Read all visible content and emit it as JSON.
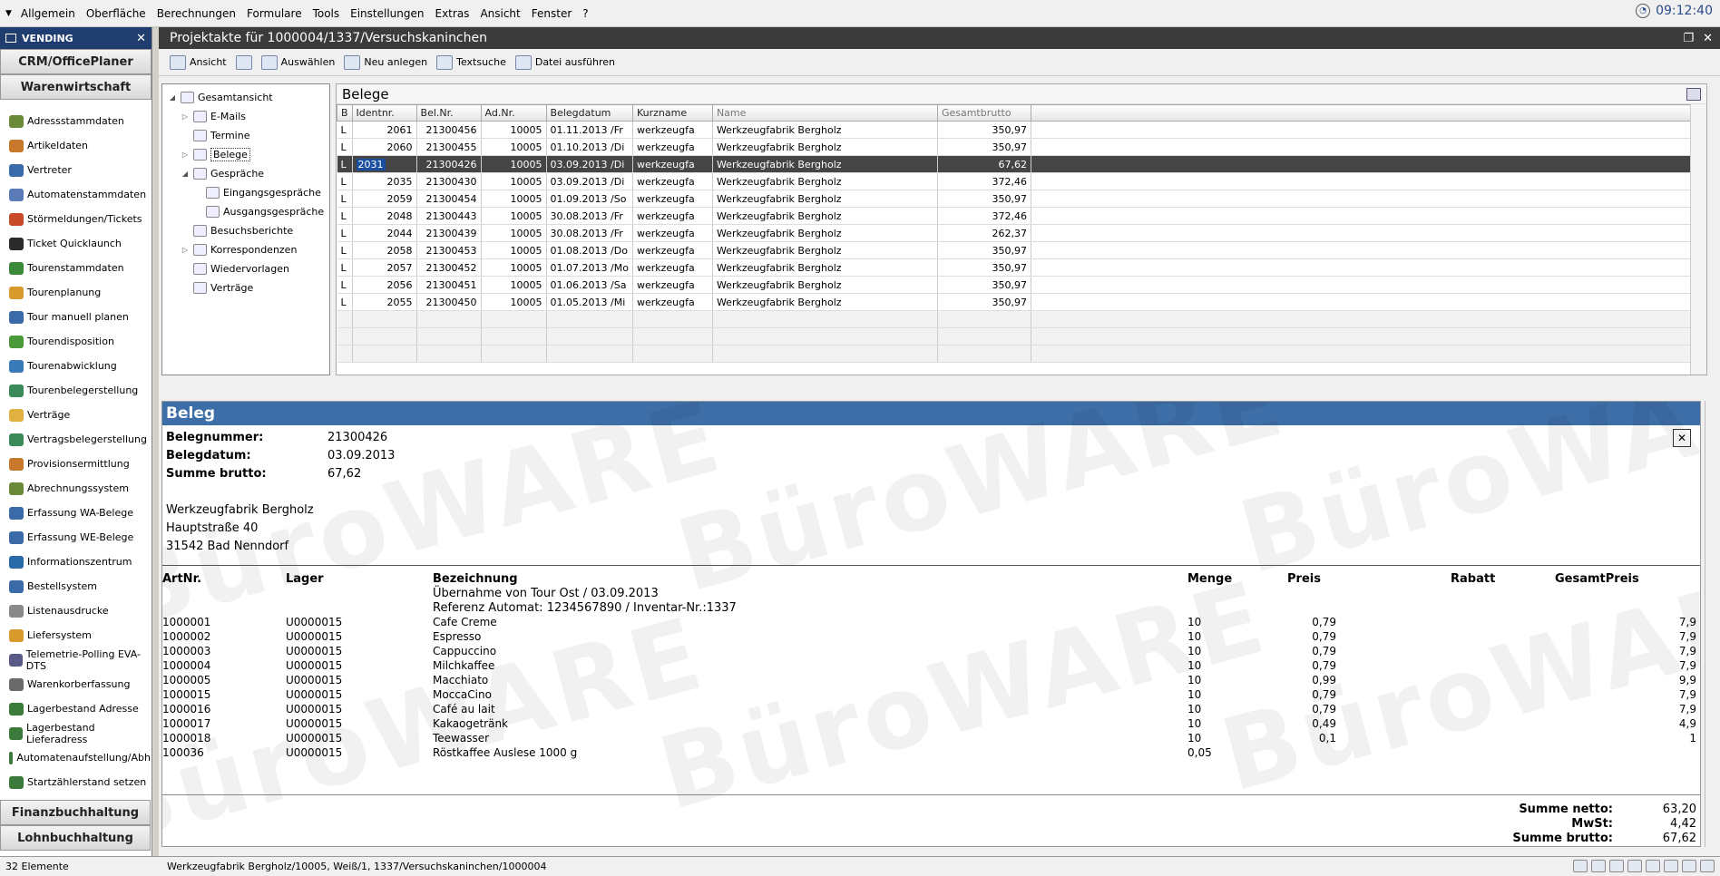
{
  "menu": [
    "Allgemein",
    "Oberfläche",
    "Berechnungen",
    "Formulare",
    "Tools",
    "Einstellungen",
    "Extras",
    "Ansicht",
    "Fenster",
    "?"
  ],
  "clock": "09:12:40",
  "leftnav": {
    "header": "VENDING",
    "top_modules": [
      "CRM/OfficePlaner",
      "Warenwirtschaft"
    ],
    "items": [
      "Adressstammdaten",
      "Artikeldaten",
      "Vertreter",
      "Automatenstammdaten",
      "Störmeldungen/Tickets",
      "Ticket Quicklaunch",
      "Tourenstammdaten",
      "Tourenplanung",
      "Tour manuell planen",
      "Tourendisposition",
      "Tourenabwicklung",
      "Tourenbelegerstellung",
      "Verträge",
      "Vertragsbelegerstellung",
      "Provisionsermittlung",
      "Abrechnungssystem",
      "Erfassung WA-Belege",
      "Erfassung WE-Belege",
      "Informationszentrum",
      "Bestellsystem",
      "Listenausdrucke",
      "Liefersystem",
      "Telemetrie-Polling EVA-DTS",
      "Warenkorberfassung",
      "Lagerbestand Adresse",
      "Lagerbestand Lieferadress",
      "Automatenaufstellung/Abh",
      "Startzählerstand setzen"
    ],
    "item_colors": [
      "#6a8a3a",
      "#c8782a",
      "#3a6aa8",
      "#5a7ab8",
      "#c84a2a",
      "#2a2a2a",
      "#3a8a3a",
      "#d89a2a",
      "#3a6aa8",
      "#4a9a3a",
      "#3a7ab8",
      "#3a8a5a",
      "#e0b040",
      "#3a8a5a",
      "#c8782a",
      "#6a8a3a",
      "#3a6aa8",
      "#3a6aa8",
      "#2a6aa8",
      "#3a6aa8",
      "#8a8a8a",
      "#d89a2a",
      "#5a5a8a",
      "#6a6a6a",
      "#3a7a3a",
      "#3a7a3a",
      "#3a7a3a",
      "#3a7a3a"
    ],
    "bottom_modules": [
      "Finanzbuchhaltung",
      "Lohnbuchhaltung"
    ]
  },
  "window": {
    "title": "Projektakte für 1000004/1337/Versuchskaninchen"
  },
  "toolbar": [
    "Ansicht",
    "",
    "Auswählen",
    "Neu anlegen",
    "Textsuche",
    "Datei ausführen"
  ],
  "tree": [
    {
      "label": "Gesamtansicht",
      "level": 0,
      "toggle": "◢"
    },
    {
      "label": "E-Mails",
      "level": 1,
      "toggle": "▷"
    },
    {
      "label": "Termine",
      "level": 1,
      "toggle": ""
    },
    {
      "label": "Belege",
      "level": 1,
      "toggle": "▷"
    },
    {
      "label": "Gespräche",
      "level": 1,
      "toggle": "◢"
    },
    {
      "label": "Eingangsgespräche",
      "level": 2,
      "toggle": ""
    },
    {
      "label": "Ausgangsgespräche",
      "level": 2,
      "toggle": ""
    },
    {
      "label": "Besuchsberichte",
      "level": 1,
      "toggle": ""
    },
    {
      "label": "Korrespondenzen",
      "level": 1,
      "toggle": "▷"
    },
    {
      "label": "Wiedervorlagen",
      "level": 1,
      "toggle": ""
    },
    {
      "label": "Verträge",
      "level": 1,
      "toggle": ""
    }
  ],
  "grid": {
    "title": "Belege",
    "columns": [
      "B",
      "Identnr.",
      "Bel.Nr.",
      "Ad.Nr.",
      "Belegdatum",
      "Kurzname",
      "Name",
      "Gesamtbrutto"
    ],
    "rows": [
      [
        "L",
        "2061",
        "21300456",
        "10005",
        "01.11.2013 /Fr",
        "werkzeugfa",
        "Werkzeugfabrik Bergholz",
        "350,97"
      ],
      [
        "L",
        "2060",
        "21300455",
        "10005",
        "01.10.2013 /Di",
        "werkzeugfa",
        "Werkzeugfabrik Bergholz",
        "350,97"
      ],
      [
        "L",
        "2031",
        "21300426",
        "10005",
        "03.09.2013 /Di",
        "werkzeugfa",
        "Werkzeugfabrik Bergholz",
        "67,62"
      ],
      [
        "L",
        "2035",
        "21300430",
        "10005",
        "03.09.2013 /Di",
        "werkzeugfa",
        "Werkzeugfabrik Bergholz",
        "372,46"
      ],
      [
        "L",
        "2059",
        "21300454",
        "10005",
        "01.09.2013 /So",
        "werkzeugfa",
        "Werkzeugfabrik Bergholz",
        "350,97"
      ],
      [
        "L",
        "2048",
        "21300443",
        "10005",
        "30.08.2013 /Fr",
        "werkzeugfa",
        "Werkzeugfabrik Bergholz",
        "372,46"
      ],
      [
        "L",
        "2044",
        "21300439",
        "10005",
        "30.08.2013 /Fr",
        "werkzeugfa",
        "Werkzeugfabrik Bergholz",
        "262,37"
      ],
      [
        "L",
        "2058",
        "21300453",
        "10005",
        "01.08.2013 /Do",
        "werkzeugfa",
        "Werkzeugfabrik Bergholz",
        "350,97"
      ],
      [
        "L",
        "2057",
        "21300452",
        "10005",
        "01.07.2013 /Mo",
        "werkzeugfa",
        "Werkzeugfabrik Bergholz",
        "350,97"
      ],
      [
        "L",
        "2056",
        "21300451",
        "10005",
        "01.06.2013 /Sa",
        "werkzeugfa",
        "Werkzeugfabrik Bergholz",
        "350,97"
      ],
      [
        "L",
        "2055",
        "21300450",
        "10005",
        "01.05.2013 /Mi",
        "werkzeugfa",
        "Werkzeugfabrik Bergholz",
        "350,97"
      ]
    ],
    "selected_index": 2
  },
  "detail": {
    "title": "Beleg",
    "watermark": "BüroWARE",
    "fields": [
      {
        "k": "Belegnummer:",
        "v": "21300426"
      },
      {
        "k": "Belegdatum:",
        "v": "03.09.2013"
      },
      {
        "k": "Summe brutto:",
        "v": "67,62"
      }
    ],
    "address": [
      "Werkzeugfabrik Bergholz",
      "Hauptstraße 40",
      "31542 Bad Nenndorf"
    ],
    "pos_headers": [
      "ArtNr.",
      "Lager",
      "Bezeichnung",
      "Menge",
      "Preis",
      "Rabatt",
      "GesamtPreis"
    ],
    "pos_info": [
      "Übernahme von Tour Ost / 03.09.2013",
      "Referenz Automat: 1234567890 / Inventar-Nr.:1337"
    ],
    "positions": [
      [
        "1000001",
        "U0000015",
        "Cafe Creme",
        "10",
        "0,79",
        "7,9"
      ],
      [
        "1000002",
        "U0000015",
        "Espresso",
        "10",
        "0,79",
        "7,9"
      ],
      [
        "1000003",
        "U0000015",
        "Cappuccino",
        "10",
        "0,79",
        "7,9"
      ],
      [
        "1000004",
        "U0000015",
        "Milchkaffee",
        "10",
        "0,79",
        "7,9"
      ],
      [
        "1000005",
        "U0000015",
        "Macchiato",
        "10",
        "0,99",
        "9,9"
      ],
      [
        "1000015",
        "U0000015",
        "MoccaCino",
        "10",
        "0,79",
        "7,9"
      ],
      [
        "1000016",
        "U0000015",
        "Café au lait",
        "10",
        "0,79",
        "7,9"
      ],
      [
        "1000017",
        "U0000015",
        "Kakaogetränk",
        "10",
        "0,49",
        "4,9"
      ],
      [
        "1000018",
        "U0000015",
        "Teewasser",
        "10",
        "0,1",
        "1"
      ],
      [
        "100036",
        "U0000015",
        "Röstkaffee Auslese 1000 g",
        "0,05",
        "",
        ""
      ]
    ],
    "totals": [
      {
        "k": "Summe netto:",
        "v": "63,20"
      },
      {
        "k": "MwSt:",
        "v": "4,42"
      },
      {
        "k": "Summe brutto:",
        "v": "67,62"
      }
    ]
  },
  "status": {
    "count": "32 Elemente",
    "path": "Werkzeugfabrik Bergholz/10005, Weiß/1, 1337/Versuchskaninchen/1000004"
  }
}
